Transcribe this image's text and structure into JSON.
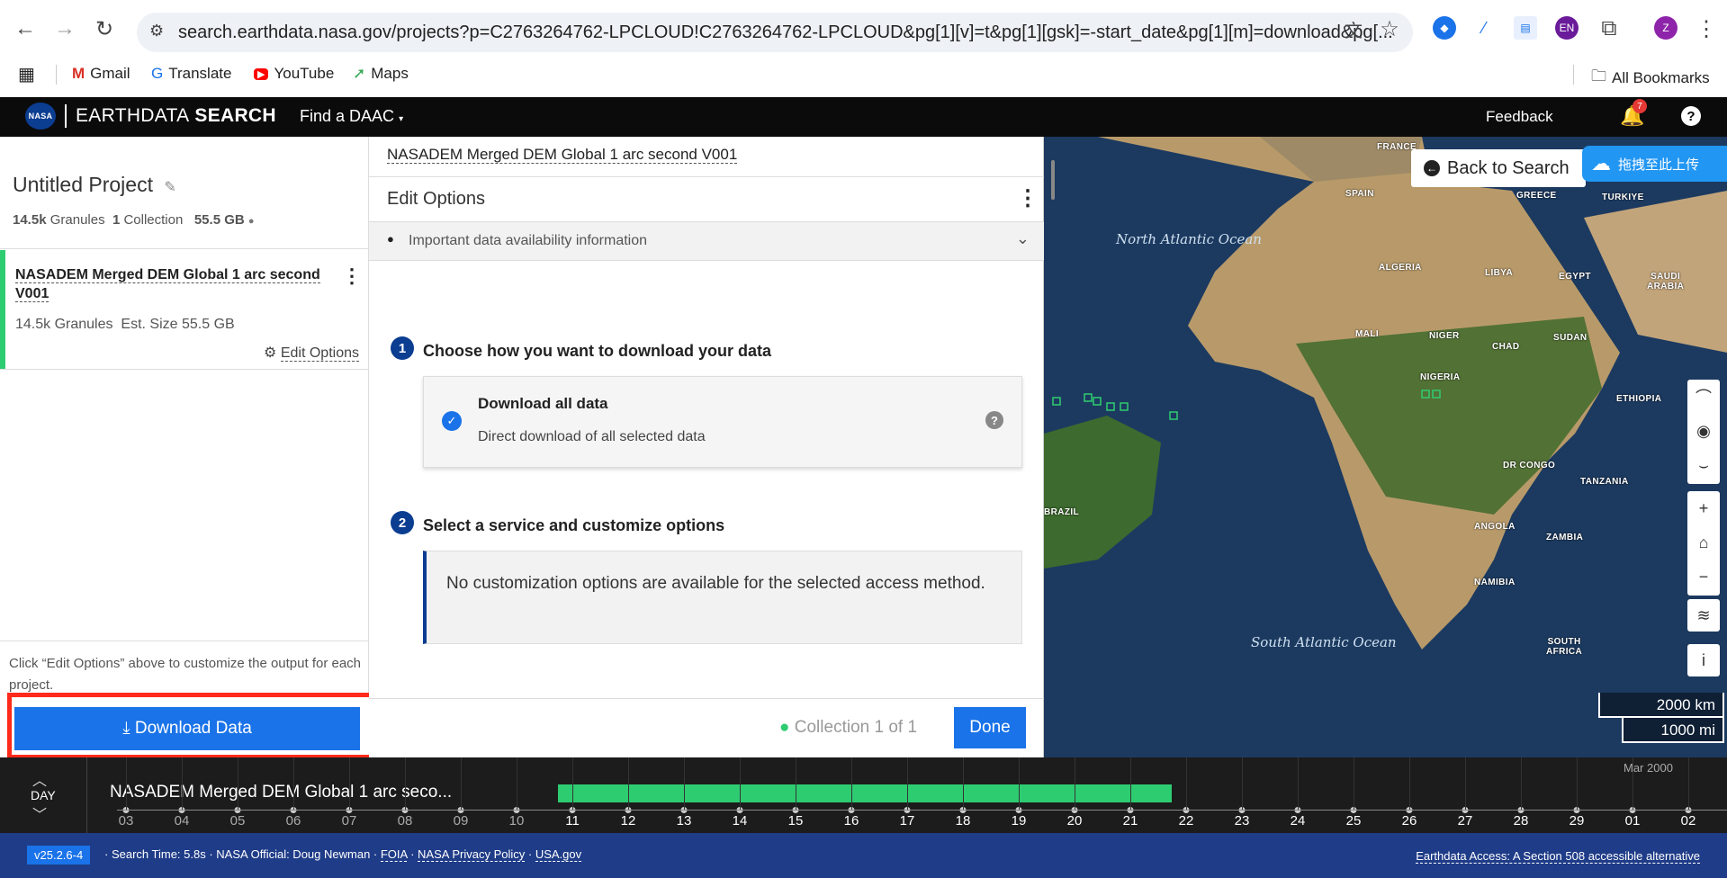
{
  "browser": {
    "url": "search.earthdata.nasa.gov/projects?p=C2763264762-LPCLOUD!C2763264762-LPCLOUD&pg[1][v]=t&pg[1][gsk]=-start_date&pg[1][m]=download&pg[...",
    "notification_count": "7",
    "profile_initial": "Z",
    "ext_badge": "EN",
    "bookmarks": [
      "Gmail",
      "Translate",
      "YouTube",
      "Maps"
    ],
    "all_bookmarks": "All Bookmarks"
  },
  "app": {
    "brand": "EARTHDATA SEARCH",
    "brand_bold": "SEARCH",
    "brand_light": "EARTHDATA",
    "find_daac": "Find a DAAC",
    "feedback": "Feedback",
    "notifications": "7",
    "nasa_logo": "NASA"
  },
  "project": {
    "title": "Untitled Project",
    "granules_count": "14.5k",
    "granules_label": "Granules",
    "collection_count": "1",
    "collection_label": "Collection",
    "size": "55.5 GB",
    "collection_title": "NASADEM Merged DEM Global 1 arc second V001",
    "collection_granules": "14.5k Granules",
    "collection_est": "Est. Size 55.5 GB",
    "edit_options": "Edit Options",
    "hint": "Click “Edit Options” above to customize the output for each project.",
    "download_button": "Download Data"
  },
  "panel": {
    "collection_title": "NASADEM Merged DEM Global 1 arc second V001",
    "header": "Edit Options",
    "availability": "Important data availability information",
    "step1_number": "1",
    "step1_title": "Choose how you want to download your data",
    "option_title": "Download all data",
    "option_desc": "Direct download of all selected data",
    "step2_number": "2",
    "step2_title": "Select a service and customize options",
    "no_custom": "No customization options are available for the selected access method.",
    "collection_count": "Collection 1 of 1",
    "done": "Done"
  },
  "map": {
    "back_to_search": "Back to Search",
    "upload_badge": "拖拽至此上传",
    "scale_km": "2000 km",
    "scale_mi": "1000 mi",
    "labels": [
      "FRANCE",
      "SPAIN",
      "GREECE",
      "TURKIYE",
      "ALGERIA",
      "LIBYA",
      "EGYPT",
      "SAUDI ARABIA",
      "MALI",
      "NIGER",
      "CHAD",
      "SUDAN",
      "NIGERIA",
      "ETHIOPIA",
      "DR CONGO",
      "TANZANIA",
      "ANGOLA",
      "ZAMBIA",
      "NAMIBIA",
      "SOUTH AFRICA",
      "BRAZIL"
    ],
    "oceans": [
      "North Atlantic Ocean",
      "South Atlantic Ocean"
    ]
  },
  "timeline": {
    "interval": "DAY",
    "collection": "NASADEM Merged DEM Global 1 arc seco...",
    "month_label": "Mar 2000",
    "ticks": [
      "03",
      "04",
      "05",
      "06",
      "07",
      "08",
      "09",
      "10",
      "11",
      "12",
      "13",
      "14",
      "15",
      "16",
      "17",
      "18",
      "19",
      "20",
      "21",
      "22",
      "23",
      "24",
      "25",
      "26",
      "27",
      "28",
      "29",
      "01",
      "02"
    ]
  },
  "footer": {
    "version": "v25.2.6-4",
    "search_time": "Search Time: 5.8s",
    "official": "NASA Official: Doug Newman",
    "foia": "FOIA",
    "privacy": "NASA Privacy Policy",
    "usa": "USA.gov",
    "accessible": "Earthdata Access: A Section 508 accessible alternative"
  },
  "colors": {
    "primary": "#1a73e8",
    "green": "#2ecc71",
    "highlight_red": "#ff2a1a",
    "footer_blue": "#1f3c88"
  }
}
